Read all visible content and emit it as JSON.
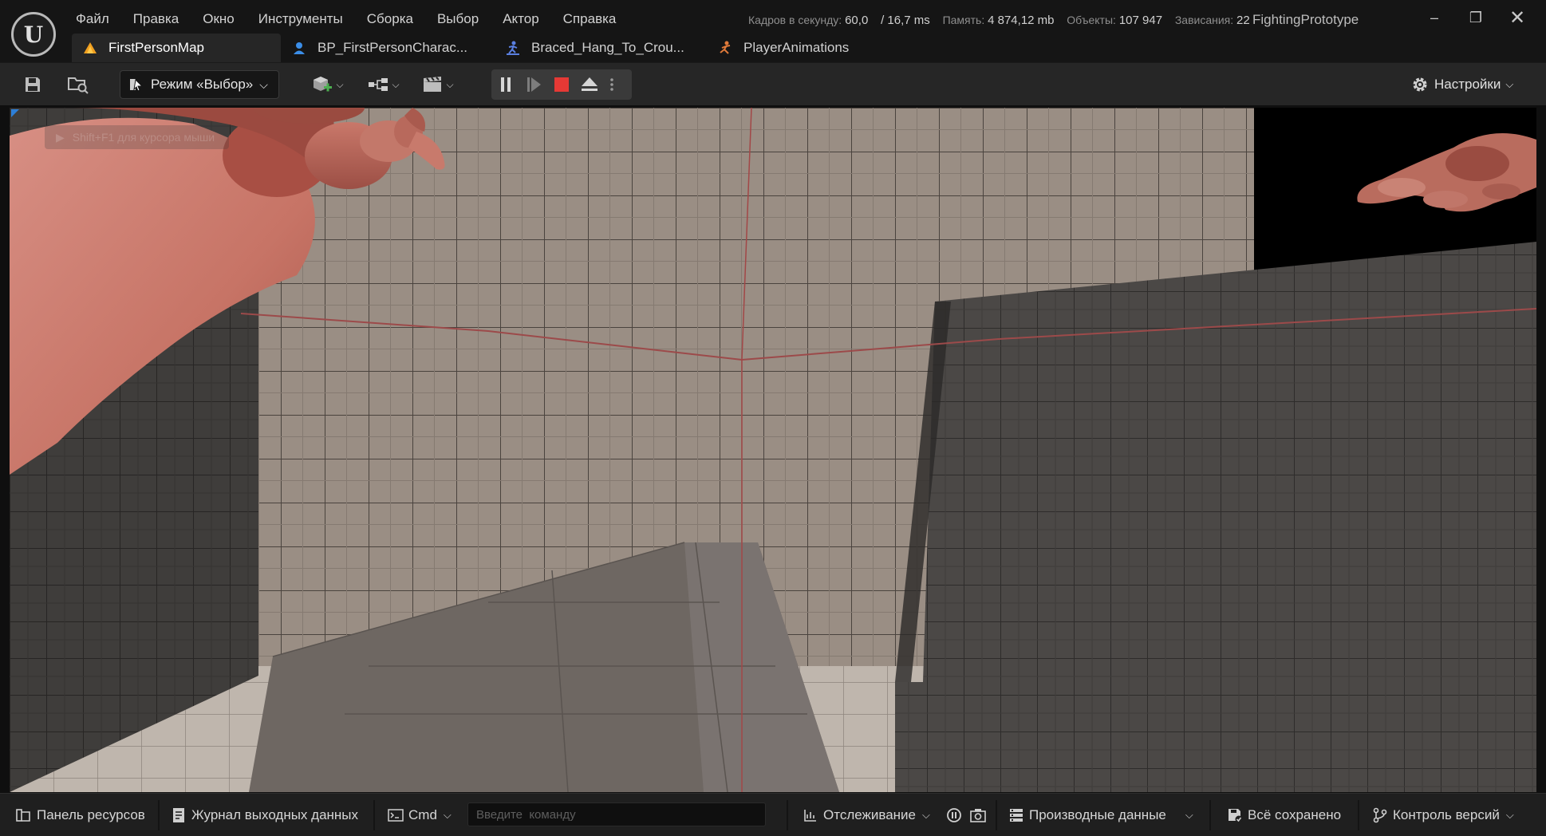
{
  "menu": [
    "Файл",
    "Правка",
    "Окно",
    "Инструменты",
    "Сборка",
    "Выбор",
    "Актор",
    "Справка"
  ],
  "stats": {
    "fps_label": "Кадров в секунду:",
    "fps_value": "60,0",
    "ms_value": "/ 16,7 ms",
    "memory_label": "Память:",
    "memory_value": "4 874,12 mb",
    "objects_label": "Объекты:",
    "objects_value": "107 947",
    "hitches_label": "Зависания:",
    "hitches_value": "22"
  },
  "project_name": "FightingPrototype",
  "window_controls": {
    "minimize": "–",
    "restore": "❐",
    "close": "✕"
  },
  "tabs": [
    {
      "label": "FirstPersonMap",
      "icon": "level-icon",
      "active": true
    },
    {
      "label": "BP_FirstPersonCharac...",
      "icon": "blueprint-icon",
      "active": false
    },
    {
      "label": "Braced_Hang_To_Crou...",
      "icon": "animation-sequence-icon",
      "active": false
    },
    {
      "label": "PlayerAnimations",
      "icon": "animation-blueprint-icon",
      "active": false
    }
  ],
  "toolbar": {
    "mode_label": "Режим «Выбор»",
    "settings_label": "Настройки"
  },
  "viewport": {
    "hint_text": "Shift+F1 для курсора мыши"
  },
  "statusbar": {
    "content_browser": "Панель ресурсов",
    "output_log": "Журнал выходных данных",
    "cmd_label": "Cmd",
    "cmd_placeholder": "Введите  команду",
    "trace_label": "Отслеживание",
    "derived_data": "Производные данные",
    "save_status": "Всё сохранено",
    "source_control": "Контроль версий"
  },
  "colors": {
    "accent_blue": "#2d7fd8",
    "stop_red": "#e53935",
    "panel_dark": "#151515",
    "toolbar": "#262626"
  }
}
